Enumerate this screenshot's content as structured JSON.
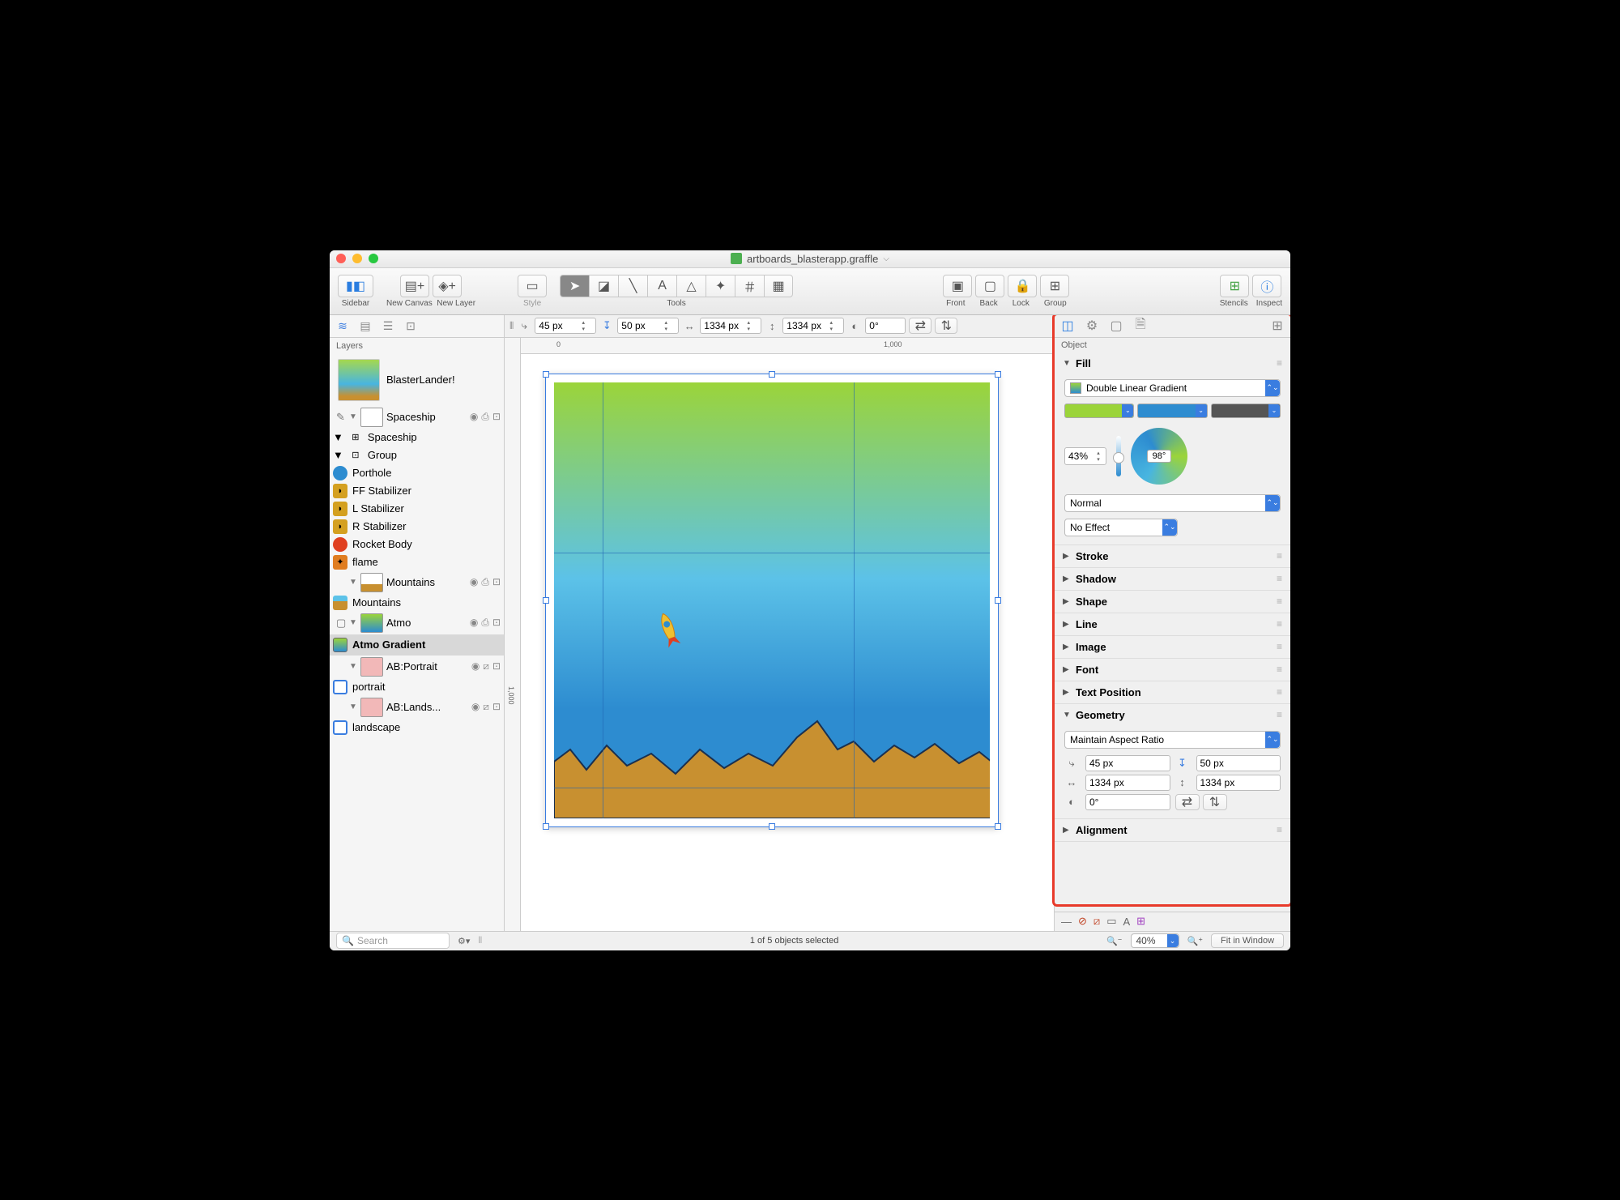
{
  "window": {
    "title": "artboards_blasterapp.graffle"
  },
  "toolbar": {
    "sidebar": "Sidebar",
    "new_canvas": "New Canvas",
    "new_layer": "New Layer",
    "style": "Style",
    "tools": "Tools",
    "front": "Front",
    "back": "Back",
    "lock": "Lock",
    "group": "Group",
    "stencils": "Stencils",
    "inspect": "Inspect"
  },
  "geom_bar": {
    "x": "45 px",
    "y": "50 px",
    "w": "1334 px",
    "h": "1334 px",
    "rot": "0°"
  },
  "ruler": {
    "t0": "0",
    "t1": "1,000",
    "v0": "1,000"
  },
  "sidebar": {
    "title": "Layers",
    "canvas": "BlasterLander!",
    "layers": [
      {
        "name": "Spaceship",
        "children": [
          {
            "name": "Spaceship",
            "children": [
              {
                "name": "Group",
                "children": [
                  {
                    "name": "Porthole"
                  },
                  {
                    "name": "FF Stabilizer"
                  },
                  {
                    "name": "L Stabilizer"
                  },
                  {
                    "name": "R Stabilizer"
                  },
                  {
                    "name": "Rocket Body"
                  }
                ]
              },
              {
                "name": "flame"
              }
            ]
          }
        ]
      },
      {
        "name": "Mountains",
        "children": [
          {
            "name": "Mountains"
          }
        ]
      },
      {
        "name": "Atmo",
        "children": [
          {
            "name": "Atmo Gradient",
            "selected": true
          }
        ]
      },
      {
        "name": "AB:Portrait",
        "children": [
          {
            "name": "portrait"
          }
        ]
      },
      {
        "name": "AB:Lands...",
        "full": "AB:Landscape",
        "children": [
          {
            "name": "landscape"
          }
        ]
      }
    ],
    "search_placeholder": "Search"
  },
  "status": {
    "selection": "1 of 5 objects selected",
    "zoom": "40%",
    "fit": "Fit in Window"
  },
  "inspector": {
    "tab": "Object",
    "sections": {
      "fill": {
        "label": "Fill",
        "type": "Double Linear Gradient",
        "midpoint": "43%",
        "angle": "98°",
        "blend": "Normal",
        "effect": "No Effect",
        "color1": "#9bd43a",
        "color2": "#2d8cd0",
        "color3": "#555555"
      },
      "stroke": "Stroke",
      "shadow": "Shadow",
      "shape": "Shape",
      "line": "Line",
      "image": "Image",
      "font": "Font",
      "text_position": "Text Position",
      "geometry": {
        "label": "Geometry",
        "aspect": "Maintain Aspect Ratio",
        "x": "45 px",
        "y": "50 px",
        "w": "1334 px",
        "h": "1334 px",
        "rot": "0°"
      },
      "alignment": "Alignment"
    }
  }
}
